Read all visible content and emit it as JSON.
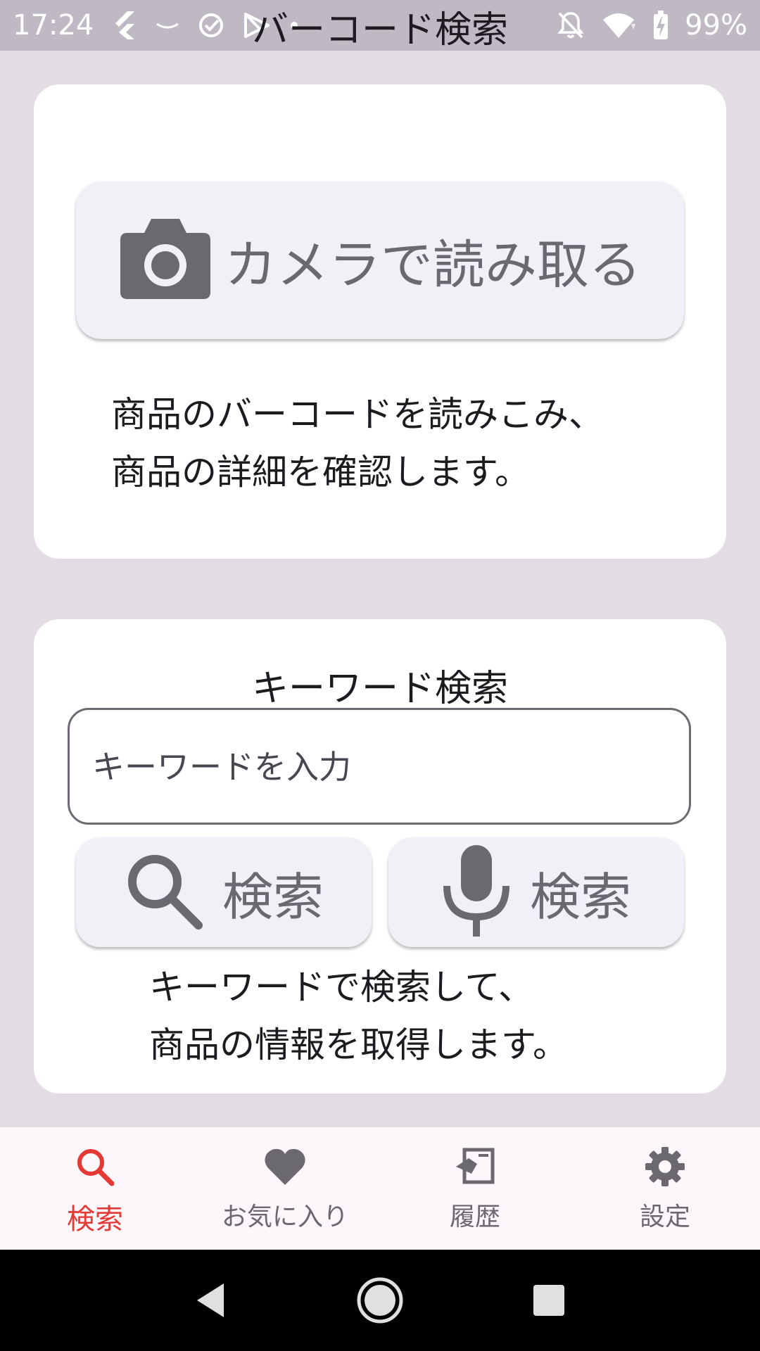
{
  "status_bar": {
    "time": "17:24",
    "battery_text": "99%",
    "left_icons": [
      "flutter-icon",
      "dash-icon",
      "check-circle-icon",
      "play-store-icon",
      "dot-icon"
    ],
    "right_icons": [
      "notifications-off-icon",
      "wifi-icon",
      "battery-charging-icon"
    ]
  },
  "barcode_card": {
    "title": "バーコード検索",
    "camera_button_label": "カメラで読み取る",
    "camera_icon": "camera-icon",
    "description_line1": "商品のバーコードを読みこみ、",
    "description_line2": "商品の詳細を確認します。"
  },
  "keyword_card": {
    "title": "キーワード検索",
    "input_placeholder": "キーワードを入力",
    "input_value": "",
    "search_button_label": "検索",
    "search_icon": "search-icon",
    "voice_button_label": "検索",
    "voice_icon": "microphone-icon",
    "description_line1": "キーワードで検索して、",
    "description_line2": "商品の情報を取得します。"
  },
  "bottom_nav": {
    "items": [
      {
        "label": "検索",
        "icon": "search-icon",
        "active": true
      },
      {
        "label": "お気に入り",
        "icon": "heart-icon",
        "active": false
      },
      {
        "label": "履歴",
        "icon": "history-icon",
        "active": false
      },
      {
        "label": "設定",
        "icon": "gear-icon",
        "active": false
      }
    ],
    "active_color": "#e53935",
    "inactive_color": "#6b6870"
  },
  "system_nav": {
    "buttons": [
      "back-icon",
      "home-icon",
      "recents-icon"
    ]
  }
}
